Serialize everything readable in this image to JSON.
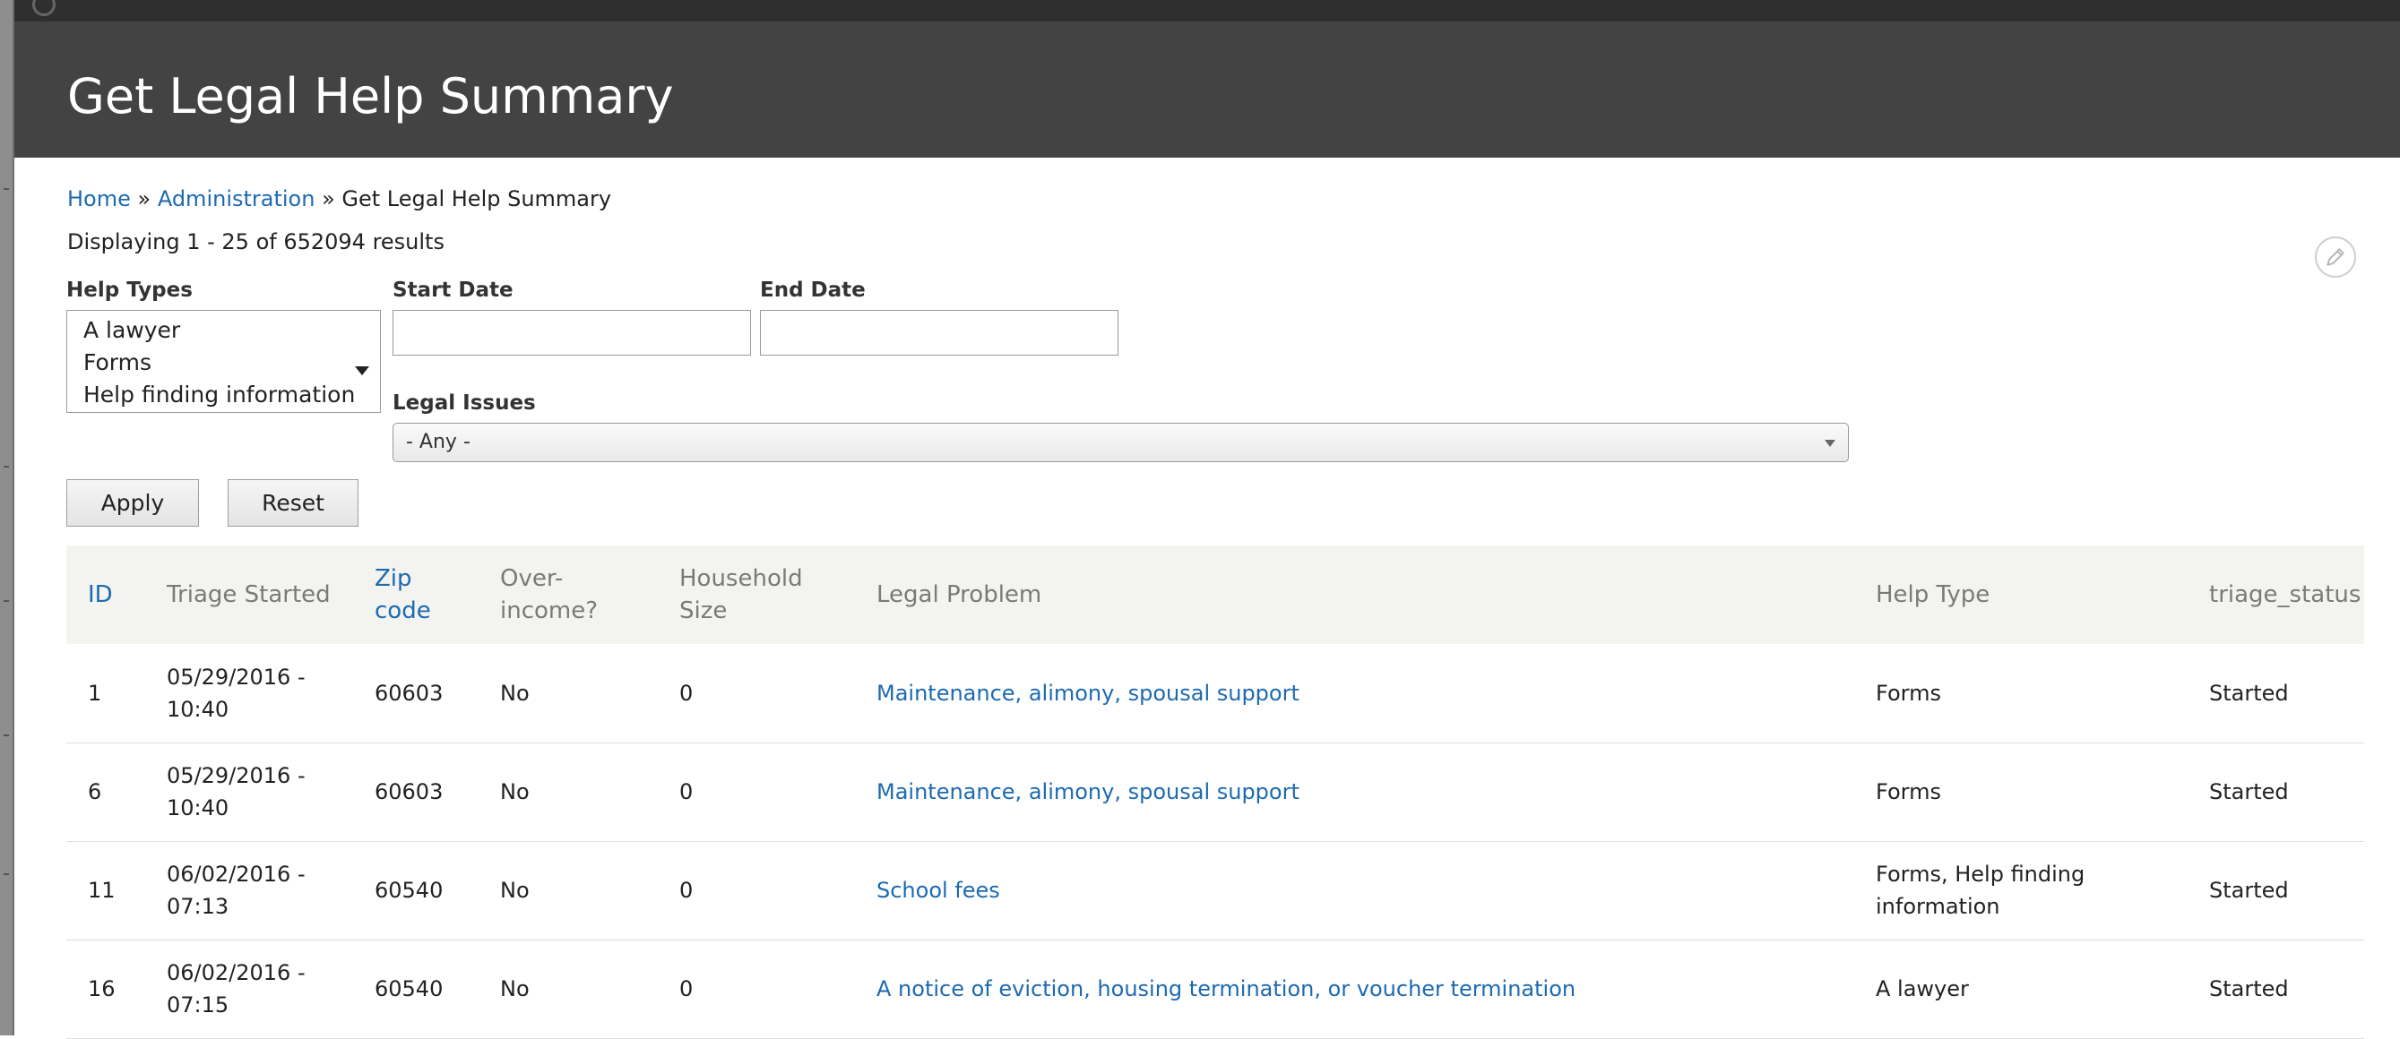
{
  "page_title": "Get Legal Help Summary",
  "breadcrumb": {
    "home": "Home",
    "sep1": " » ",
    "admin": "Administration",
    "sep2": " » ",
    "current": "Get Legal Help Summary"
  },
  "result_count": "Displaying 1 - 25 of 652094 results",
  "filters": {
    "help_types": {
      "label": "Help Types",
      "options": [
        "A lawyer",
        "Forms",
        "Help finding information"
      ]
    },
    "start_date": {
      "label": "Start Date",
      "value": ""
    },
    "end_date": {
      "label": "End Date",
      "value": ""
    },
    "legal_issues": {
      "label": "Legal Issues",
      "value": "- Any -"
    }
  },
  "buttons": {
    "apply": "Apply",
    "reset": "Reset"
  },
  "table": {
    "headers": {
      "id": "ID",
      "triage_started": "Triage Started",
      "zip_line1": "Zip",
      "zip_line2": "code",
      "over_line1": "Over-",
      "over_line2": "income?",
      "household_line1": "Household",
      "household_line2": "Size",
      "legal_problem": "Legal Problem",
      "help_type": "Help Type",
      "triage_status": "triage_status"
    },
    "rows": [
      {
        "id": "1",
        "date": "05/29/2016 -",
        "time": "10:40",
        "zip": "60603",
        "over_income": "No",
        "household": "0",
        "legal_problem": "Maintenance, alimony, spousal support",
        "help_type_line1": "Forms",
        "help_type_line2": "",
        "status": "Started"
      },
      {
        "id": "6",
        "date": "05/29/2016 -",
        "time": "10:40",
        "zip": "60603",
        "over_income": "No",
        "household": "0",
        "legal_problem": "Maintenance, alimony, spousal support",
        "help_type_line1": "Forms",
        "help_type_line2": "",
        "status": "Started"
      },
      {
        "id": "11",
        "date": "06/02/2016 -",
        "time": "07:13",
        "zip": "60540",
        "over_income": "No",
        "household": "0",
        "legal_problem": "School fees",
        "help_type_line1": "Forms, Help finding",
        "help_type_line2": "information",
        "status": "Started"
      },
      {
        "id": "16",
        "date": "06/02/2016 -",
        "time": "07:15",
        "zip": "60540",
        "over_income": "No",
        "household": "0",
        "legal_problem": "A notice of eviction, housing termination, or voucher termination",
        "help_type_line1": "A lawyer",
        "help_type_line2": "",
        "status": "Started"
      }
    ]
  }
}
